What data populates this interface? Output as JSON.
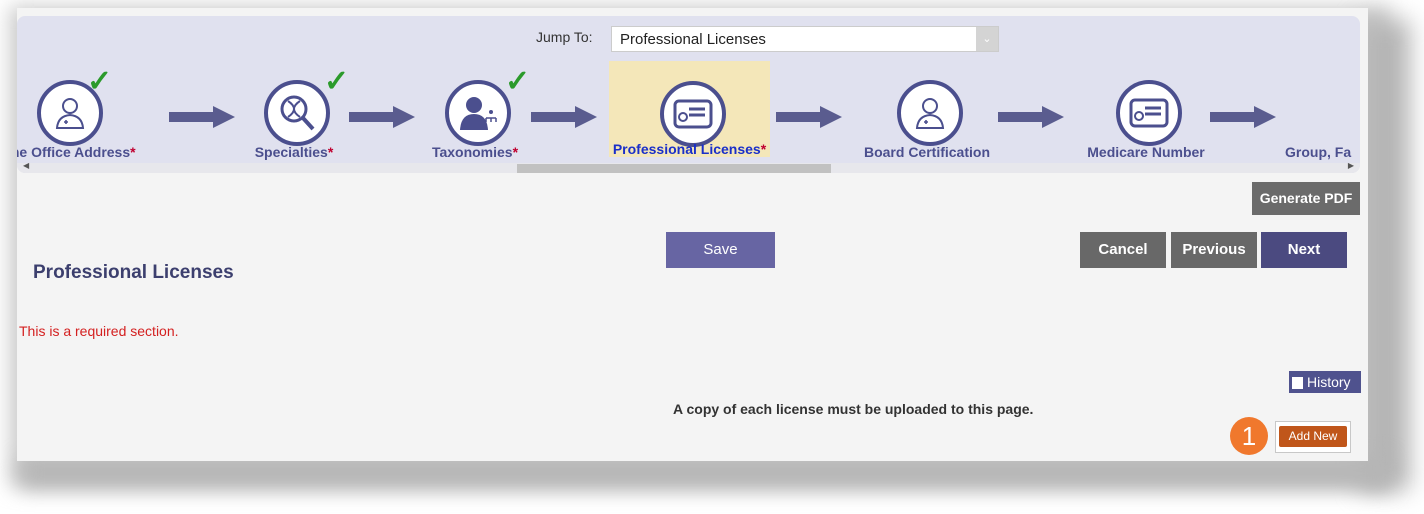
{
  "jump": {
    "label": "Jump To:",
    "selected": "Professional Licenses"
  },
  "steps": [
    {
      "label": "ome Office Address",
      "required": "*",
      "icon": "doctor-icon",
      "done": true
    },
    {
      "label": "Specialties",
      "required": "*",
      "icon": "dna-magnifier-icon",
      "done": true
    },
    {
      "label": "Taxonomies",
      "required": "*",
      "icon": "woman-hierarchy-icon",
      "done": true
    },
    {
      "label": "Professional Licenses",
      "required": "*",
      "icon": "certificate-icon",
      "done": false,
      "active": true
    },
    {
      "label": "Board Certification",
      "required": "",
      "icon": "doctor-icon",
      "done": false
    },
    {
      "label": "Medicare Number",
      "required": "",
      "icon": "certificate-icon",
      "done": false
    },
    {
      "label": "Group, Fa",
      "required": "",
      "icon": "",
      "done": false
    }
  ],
  "checkmark": "✓",
  "scroll": {
    "left": "◀",
    "right": "▶"
  },
  "buttons": {
    "generate_pdf": "Generate PDF",
    "save": "Save",
    "cancel": "Cancel",
    "previous": "Previous",
    "next": "Next",
    "history": "History",
    "add_new": "Add New"
  },
  "page": {
    "title": "Professional Licenses",
    "required_note": "This is a required section.",
    "notice": "A copy of each license must be uploaded to this page."
  },
  "callout": {
    "number": "1"
  },
  "colors": {
    "accent": "#4b4f8e",
    "active_bg": "#f4e7b9",
    "required": "#d42020",
    "add_new": "#c0561a",
    "callout": "#f0782d",
    "check": "#2b9a2b"
  }
}
